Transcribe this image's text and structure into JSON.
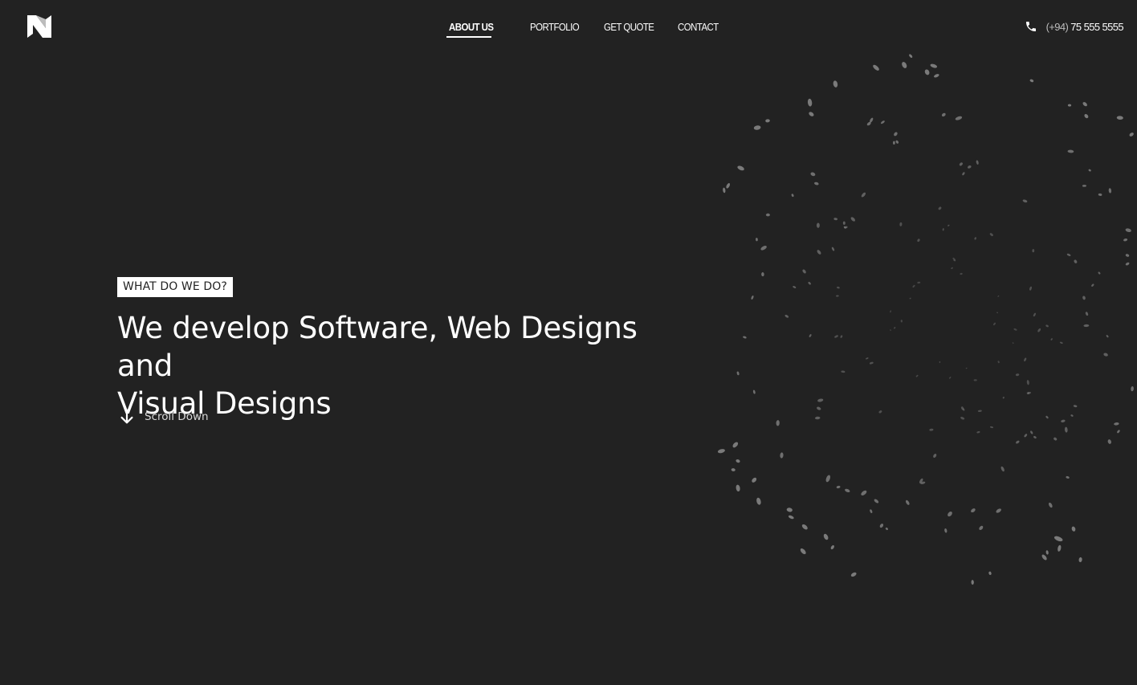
{
  "header": {
    "logo_icon": "brand-logo-icon",
    "nav": [
      {
        "label": "ABOUT US",
        "active": true
      },
      {
        "label": "PORTFOLIO",
        "active": false
      },
      {
        "label": "GET QUOTE",
        "active": false
      },
      {
        "label": "CONTACT",
        "active": false
      }
    ],
    "phone": {
      "icon": "phone-icon",
      "code": "(+94)",
      "number": "75 555 5555"
    }
  },
  "hero": {
    "tag": "WHAT DO WE DO?",
    "headline_line1": "We develop Software, Web Designs and",
    "headline_line2": "Visual Designs",
    "scroll_icon": "arrow-down-icon",
    "scroll_label": "Scroll Down"
  },
  "colors": {
    "background": "#222222",
    "text": "#ffffff",
    "particles": "#8a8a8a"
  }
}
